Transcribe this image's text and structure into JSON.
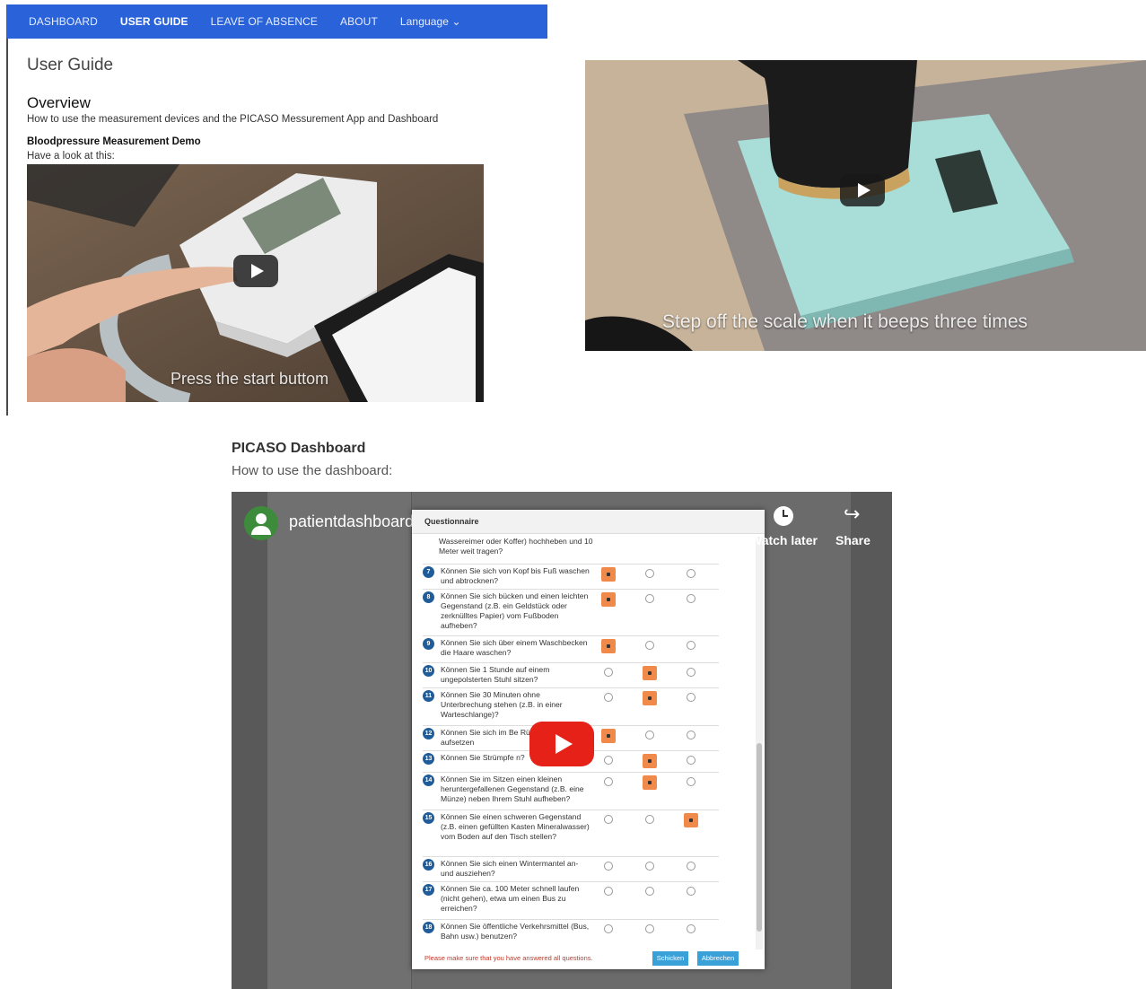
{
  "nav": {
    "items": [
      {
        "label": "DASHBOARD",
        "active": false
      },
      {
        "label": "USER GUIDE",
        "active": true
      },
      {
        "label": "LEAVE OF ABSENCE",
        "active": false
      },
      {
        "label": "ABOUT",
        "active": false
      },
      {
        "label": "Language ⌄",
        "active": false
      }
    ]
  },
  "page": {
    "title": "User Guide",
    "overview_heading": "Overview",
    "overview_text": "How to use the measurement devices and the PICASO Messurement App and Dashboard",
    "bp_heading": "Bloodpressure Measurement Demo",
    "bp_text": "Have a look at this:"
  },
  "videos": {
    "bp": {
      "caption": "Press the start buttom"
    },
    "scale": {
      "caption": "Step off the scale when it beeps three times"
    }
  },
  "dashboard": {
    "heading": "PICASO Dashboard",
    "subtext": "How to use the dashboard:",
    "channel": "patientdashboard",
    "watch_later": "Watch later",
    "share": "Share",
    "modal_title": "Questionnaire",
    "top_text": "Wassereimer oder Koffer) hochheben und 10 Meter weit tragen?",
    "questions": [
      {
        "num": "7",
        "text": "Können Sie sich von Kopf bis Fuß waschen und abtrocknen?",
        "sel": 0
      },
      {
        "num": "8",
        "text": "Können Sie sich bücken und einen leichten Gegenstand (z.B. ein Geldstück oder zerknülltes Papier) vom Fußboden aufheben?",
        "sel": 0
      },
      {
        "num": "9",
        "text": "Können Sie sich über einem Waschbecken die Haare waschen?",
        "sel": 0
      },
      {
        "num": "10",
        "text": "Können Sie 1 Stunde auf einem ungepolsterten Stuhl sitzen?",
        "sel": 1
      },
      {
        "num": "11",
        "text": "Können Sie 30 Minuten ohne Unterbrechung stehen (z.B. in einer Warteschlange)?",
        "sel": 1
      },
      {
        "num": "12",
        "text": "Können Sie sich im Be Rückenlage aufsetzen",
        "sel": 0
      },
      {
        "num": "13",
        "text": "Können Sie Strümpfe n?",
        "sel": 1
      },
      {
        "num": "14",
        "text": "Können Sie im Sitzen einen kleinen heruntergefallenen Gegenstand (z.B. eine Münze) neben Ihrem Stuhl aufheben?",
        "sel": 1
      },
      {
        "num": "15",
        "text": "Können Sie einen schweren Gegenstand (z.B. einen gefüllten Kasten Mineralwasser) vom Boden auf den Tisch stellen?",
        "sel": 2
      },
      {
        "num": "16",
        "text": "Können Sie sich einen Wintermantel an- und ausziehen?",
        "sel": -1
      },
      {
        "num": "17",
        "text": "Können Sie ca. 100 Meter schnell laufen (nicht gehen), etwa um einen Bus zu erreichen?",
        "sel": -1
      },
      {
        "num": "18",
        "text": "Können Sie öffentliche Verkehrsmittel (Bus, Bahn usw.) benutzen?",
        "sel": -1
      }
    ],
    "warning": "Please make sure that you have answered all questions.",
    "send_label": "Schicken",
    "cancel_label": "Abbrechen"
  },
  "colors": {
    "nav": "#2962d9",
    "accent": "#f08a4b",
    "qnum": "#1f5c99",
    "youtube": "#e62117"
  }
}
